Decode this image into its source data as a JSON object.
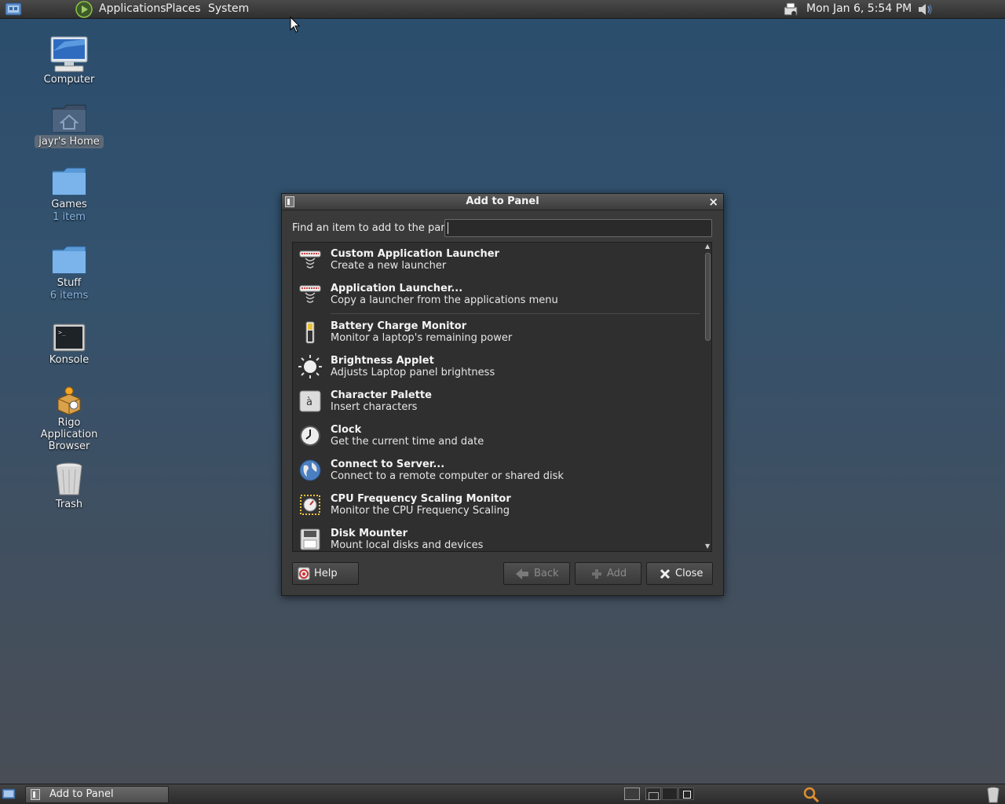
{
  "top_panel": {
    "menus": [
      "Applications",
      "Places",
      "System"
    ],
    "clock": "Mon Jan  6,  5:54 PM"
  },
  "desktop": {
    "icons": [
      {
        "label": "Computer",
        "sub": "",
        "icon": "computer-icon"
      },
      {
        "label": "jayr's Home",
        "sub": "",
        "icon": "home-folder-icon"
      },
      {
        "label": "Games",
        "sub": "1 item",
        "icon": "folder-icon"
      },
      {
        "label": "Stuff",
        "sub": "6 items",
        "icon": "folder-icon"
      },
      {
        "label": "Konsole",
        "sub": "",
        "icon": "terminal-icon"
      },
      {
        "label": "Rigo Application Browser",
        "sub": "",
        "icon": "package-icon"
      },
      {
        "label": "Trash",
        "sub": "",
        "icon": "trash-icon"
      }
    ]
  },
  "dialog": {
    "title": "Add to Panel",
    "close_glyph": "×",
    "search_label": "Find an item to add to the panel:",
    "search_value": "",
    "search_placeholder": "",
    "items": [
      {
        "name": "Custom Application Launcher",
        "desc": "Create a new launcher",
        "icon": "launcher-icon"
      },
      {
        "name": "Application Launcher...",
        "desc": "Copy a launcher from the applications menu",
        "icon": "launcher-icon"
      },
      {
        "name": "Battery Charge Monitor",
        "desc": "Monitor a laptop's remaining power",
        "icon": "battery-icon"
      },
      {
        "name": "Brightness Applet",
        "desc": "Adjusts Laptop panel brightness",
        "icon": "brightness-icon"
      },
      {
        "name": "Character Palette",
        "desc": "Insert characters",
        "icon": "character-icon"
      },
      {
        "name": "Clock",
        "desc": "Get the current time and date",
        "icon": "clock-icon"
      },
      {
        "name": "Connect to Server...",
        "desc": "Connect to a remote computer or shared disk",
        "icon": "globe-icon"
      },
      {
        "name": "CPU Frequency Scaling Monitor",
        "desc": "Monitor the CPU Frequency Scaling",
        "icon": "cpu-icon"
      },
      {
        "name": "Disk Mounter",
        "desc": "Mount local disks and devices",
        "icon": "floppy-icon"
      }
    ],
    "buttons": {
      "help": "Help",
      "back": "Back",
      "add": "Add",
      "close": "Close"
    }
  },
  "bottom_panel": {
    "task": "Add to Panel"
  },
  "colors": {
    "accent_link": "#8ab6e4",
    "dialog_bg": "#3a3a3a",
    "list_bg": "#2f2f2f"
  }
}
